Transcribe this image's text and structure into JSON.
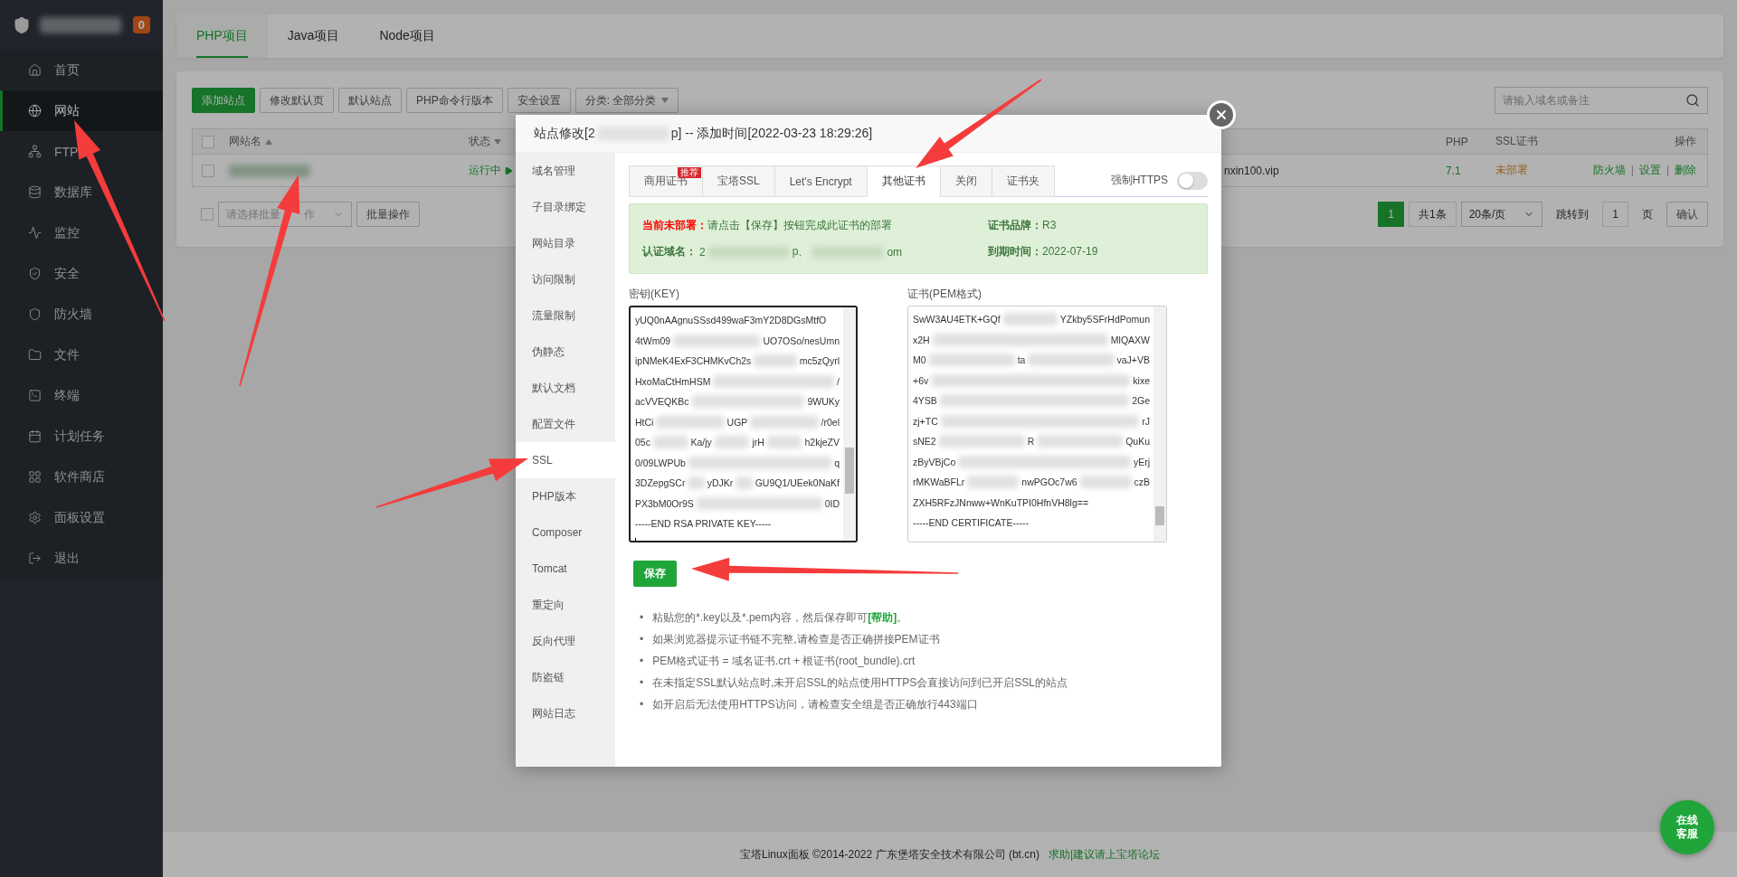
{
  "sidebar": {
    "badge": "0",
    "items": [
      {
        "label": "首页",
        "selected": false
      },
      {
        "label": "网站",
        "selected": true
      },
      {
        "label": "FTP",
        "selected": false
      },
      {
        "label": "数据库",
        "selected": false
      },
      {
        "label": "监控",
        "selected": false
      },
      {
        "label": "安全",
        "selected": false
      },
      {
        "label": "防火墙",
        "selected": false
      },
      {
        "label": "文件",
        "selected": false
      },
      {
        "label": "终端",
        "selected": false
      },
      {
        "label": "计划任务",
        "selected": false
      },
      {
        "label": "软件商店",
        "selected": false
      },
      {
        "label": "面板设置",
        "selected": false
      },
      {
        "label": "退出",
        "selected": false
      }
    ]
  },
  "project_tabs": [
    {
      "label": "PHP项目",
      "selected": true
    },
    {
      "label": "Java项目",
      "selected": false
    },
    {
      "label": "Node项目",
      "selected": false
    }
  ],
  "toolbar": {
    "buttons": [
      {
        "label": "添加站点",
        "kind": "primary"
      },
      {
        "label": "修改默认页",
        "kind": "default"
      },
      {
        "label": "默认站点",
        "kind": "default"
      },
      {
        "label": "PHP命令行版本",
        "kind": "default"
      },
      {
        "label": "安全设置",
        "kind": "default"
      },
      {
        "label": "分类: 全部分类",
        "kind": "dropdown"
      }
    ],
    "search": {
      "placeholder": "请输入域名或备注"
    }
  },
  "table": {
    "columns": {
      "name": "网站名",
      "status": "状态",
      "php": "PHP",
      "ssl": "SSL证书",
      "actions": "操作"
    },
    "header_checked": false,
    "rows": [
      {
        "checked": false,
        "status": "运行中",
        "remark": "nxin100.vip",
        "php": "7.1",
        "ssl": "未部署",
        "actions": [
          "防火墙",
          "设置",
          "删除"
        ],
        "separators": [
          "|",
          "|"
        ]
      }
    ]
  },
  "batch": {
    "checked": false,
    "prompt_parts": [
      "请选择批量",
      "作"
    ],
    "button": "批量操作"
  },
  "pagination": {
    "pages": [
      {
        "label": "1",
        "selected": true
      }
    ],
    "total": "共1条",
    "page_size": "20条/页",
    "jump_label": "跳转到",
    "jump_value": "1",
    "page_unit": "页",
    "confirm": "确认"
  },
  "modal": {
    "title_prefix": "站点修改[2",
    "title_suffix": "p] -- 添加时间[2022-03-23 18:29:26]",
    "nav": [
      {
        "label": "域名管理",
        "selected": false
      },
      {
        "label": "子目录绑定",
        "selected": false
      },
      {
        "label": "网站目录",
        "selected": false
      },
      {
        "label": "访问限制",
        "selected": false
      },
      {
        "label": "流量限制",
        "selected": false
      },
      {
        "label": "伪静态",
        "selected": false
      },
      {
        "label": "默认文档",
        "selected": false
      },
      {
        "label": "配置文件",
        "selected": false
      },
      {
        "label": "SSL",
        "selected": true
      },
      {
        "label": "PHP版本",
        "selected": false
      },
      {
        "label": "Composer",
        "selected": false
      },
      {
        "label": "Tomcat",
        "selected": false
      },
      {
        "label": "重定向",
        "selected": false
      },
      {
        "label": "反向代理",
        "selected": false
      },
      {
        "label": "防盗链",
        "selected": false
      },
      {
        "label": "网站日志",
        "selected": false
      }
    ],
    "tabs": [
      {
        "label": "商用证书",
        "selected": false,
        "ribbon": "推荐"
      },
      {
        "label": "宝塔SSL",
        "selected": false
      },
      {
        "label": "Let's Encrypt",
        "selected": false
      },
      {
        "label": "其他证书",
        "selected": true
      },
      {
        "label": "关闭",
        "selected": false
      },
      {
        "label": "证书夹",
        "selected": false
      }
    ],
    "force_https": {
      "label": "强制HTTPS",
      "on": false
    },
    "status": {
      "label": "当前未部署：",
      "message": "请点击【保存】按钮完成此证书的部署",
      "brand_label": "证书品牌：",
      "brand": "R3",
      "domain_label": "认证域名：",
      "domain_parts": [
        "2",
        "p、",
        "om"
      ],
      "expiry_label": "到期时间：",
      "expiry": "2022-07-19"
    },
    "key": {
      "label": "密钥(KEY)",
      "focused": true,
      "lines": [
        [
          "yUQ0nAAgnuSSsd499waF3mY2D8DGsMtfO"
        ],
        [
          "4tWm09",
          "UO7OSo/nesUmn"
        ],
        [
          "ipNMeK4ExF3CHMKvCh2s",
          "mc5zQyrl"
        ],
        [
          "HxoMaCtHmHSM",
          "/"
        ],
        [
          "acVVEQKBc",
          "9WUKy"
        ],
        [
          "HtCi",
          "UGP",
          "/r0el"
        ],
        [
          "05c",
          "Ka/jy",
          "jrH",
          "h2kjeZV"
        ],
        [
          "0/09LWPUb",
          "q"
        ],
        [
          "3DZepgSCr",
          "yDJKr",
          "GU9Q1/UEek0NaKf"
        ],
        [
          "PX3bM0Or9S",
          "0ID"
        ],
        [
          "-----END RSA PRIVATE KEY-----"
        ]
      ]
    },
    "cert": {
      "label": "证书(PEM格式)",
      "focused": false,
      "lines": [
        [
          "SwW3AU4ETK+GQf",
          "YZkby5SFrHdPomun"
        ],
        [
          "x2H",
          "MlQAXW"
        ],
        [
          "M0",
          "ta",
          "vaJ+VB"
        ],
        [
          "+6v",
          "kixe"
        ],
        [
          "4YSB",
          "2Ge"
        ],
        [
          "zj+TC",
          "rJ"
        ],
        [
          "sNE2",
          "R",
          "QuKu"
        ],
        [
          "zByVBjCo",
          "yErj"
        ],
        [
          "rMKWaBFLr",
          "nwPGOc7w6",
          "czB"
        ],
        [
          "ZXH5RFzJNnww+WnKuTPI0HfnVH8lg=="
        ],
        [
          "-----END CERTIFICATE-----"
        ]
      ]
    },
    "save": "保存",
    "notes": [
      {
        "bullet": "•",
        "text": "粘贴您的*.key以及*.pem内容，然后保存即可",
        "link": "[帮助]",
        "tail": "。"
      },
      {
        "bullet": "•",
        "text": "如果浏览器提示证书链不完整,请检查是否正确拼接PEM证书"
      },
      {
        "bullet": "•",
        "text": "PEM格式证书 = 域名证书.crt + 根证书(root_bundle).crt"
      },
      {
        "bullet": "•",
        "text": "在未指定SSL默认站点时,未开启SSL的站点使用HTTPS会直接访问到已开启SSL的站点"
      },
      {
        "bullet": "•",
        "text": "如开启后无法使用HTTPS访问，请检查安全组是否正确放行443端口"
      }
    ]
  },
  "footer": {
    "text": "宝塔Linux面板 ©2014-2022 广东堡塔安全技术有限公司 (bt.cn)",
    "link": "求助|建议请上宝塔论坛"
  },
  "chat_button": "在线客服"
}
